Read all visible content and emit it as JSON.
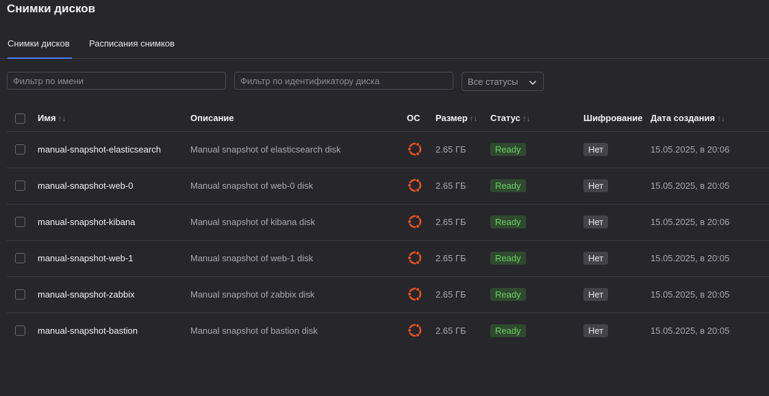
{
  "page": {
    "title": "Снимки дисков"
  },
  "tabs": [
    {
      "label": "Снимки дисков",
      "active": true
    },
    {
      "label": "Расписания снимков",
      "active": false
    }
  ],
  "filters": {
    "name_placeholder": "Фильтр по имени",
    "disk_placeholder": "Фильтр по идентификатору диска",
    "status_value": "Все статусы"
  },
  "table": {
    "headers": {
      "name": "Имя",
      "description": "Описание",
      "os": "ОС",
      "size": "Размер",
      "status": "Статус",
      "encryption": "Шифрование",
      "created": "Дата создания"
    },
    "sort_glyph": "↑↓",
    "rows": [
      {
        "name": "manual-snapshot-elasticsearch",
        "description": "Manual snapshot of elasticsearch disk",
        "os_icon": "ubuntu-icon",
        "size": "2.65 ГБ",
        "status": "Ready",
        "encryption": "Нет",
        "created": "15.05.2025, в 20:06"
      },
      {
        "name": "manual-snapshot-web-0",
        "description": "Manual snapshot of web-0 disk",
        "os_icon": "ubuntu-icon",
        "size": "2.65 ГБ",
        "status": "Ready",
        "encryption": "Нет",
        "created": "15.05.2025, в 20:05"
      },
      {
        "name": "manual-snapshot-kibana",
        "description": "Manual snapshot of kibana disk",
        "os_icon": "ubuntu-icon",
        "size": "2.65 ГБ",
        "status": "Ready",
        "encryption": "Нет",
        "created": "15.05.2025, в 20:06"
      },
      {
        "name": "manual-snapshot-web-1",
        "description": "Manual snapshot of web-1 disk",
        "os_icon": "ubuntu-icon",
        "size": "2.65 ГБ",
        "status": "Ready",
        "encryption": "Нет",
        "created": "15.05.2025, в 20:05"
      },
      {
        "name": "manual-snapshot-zabbix",
        "description": "Manual snapshot of zabbix disk",
        "os_icon": "ubuntu-icon",
        "size": "2.65 ГБ",
        "status": "Ready",
        "encryption": "Нет",
        "created": "15.05.2025, в 20:05"
      },
      {
        "name": "manual-snapshot-bastion",
        "description": "Manual snapshot of bastion disk",
        "os_icon": "ubuntu-icon",
        "size": "2.65 ГБ",
        "status": "Ready",
        "encryption": "Нет",
        "created": "15.05.2025, в 20:05"
      }
    ]
  },
  "colors": {
    "background": "#27262b",
    "accent": "#4b7bf5",
    "ubuntu_orange": "#e95420",
    "status_ready_text": "#6ccf64",
    "status_ready_bg": "#2f4a2e"
  }
}
